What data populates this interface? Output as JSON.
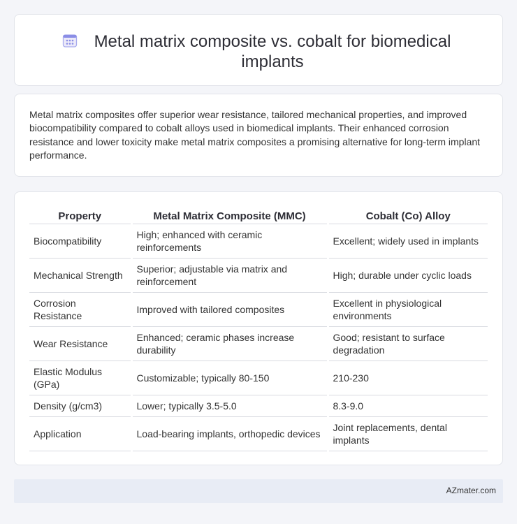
{
  "header": {
    "title": "Metal matrix composite vs. cobalt for biomedical implants",
    "icon": "calendar-grid-icon",
    "icon_color": "#7b7fe0"
  },
  "intro": {
    "text": "Metal matrix composites offer superior wear resistance, tailored mechanical properties, and improved biocompatibility compared to cobalt alloys used in biomedical implants. Their enhanced corrosion resistance and lower toxicity make metal matrix composites a promising alternative for long-term implant performance."
  },
  "table": {
    "headers": [
      "Property",
      "Metal Matrix Composite (MMC)",
      "Cobalt (Co) Alloy"
    ],
    "rows": [
      [
        "Biocompatibility",
        "High; enhanced with ceramic reinforcements",
        "Excellent; widely used in implants"
      ],
      [
        "Mechanical Strength",
        "Superior; adjustable via matrix and reinforcement",
        "High; durable under cyclic loads"
      ],
      [
        "Corrosion Resistance",
        "Improved with tailored composites",
        "Excellent in physiological environments"
      ],
      [
        "Wear Resistance",
        "Enhanced; ceramic phases increase durability",
        "Good; resistant to surface degradation"
      ],
      [
        "Elastic Modulus (GPa)",
        "Customizable; typically 80-150",
        "210-230"
      ],
      [
        "Density (g/cm3)",
        "Lower; typically 3.5-5.0",
        "8.3-9.0"
      ],
      [
        "Application",
        "Load-bearing implants, orthopedic devices",
        "Joint replacements, dental implants"
      ]
    ]
  },
  "footer": {
    "site": "AZmater.com"
  }
}
